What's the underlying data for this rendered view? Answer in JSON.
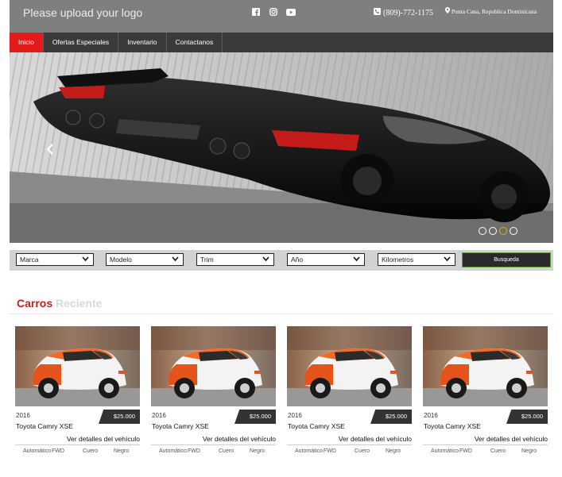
{
  "header": {
    "logo_text": "Please upload your logo",
    "social_icons": [
      "facebook-icon",
      "instagram-icon",
      "youtube-icon"
    ],
    "phone": "(809)-772-1175",
    "location": "Punta Cana, Republica Dominicana"
  },
  "nav": {
    "items": [
      {
        "label": "Inicio",
        "active": true
      },
      {
        "label": "Ofertas Especiales",
        "active": false
      },
      {
        "label": "Inventario",
        "active": false
      },
      {
        "label": "Contactanos",
        "active": false
      }
    ]
  },
  "slider": {
    "prev_icon": "chevron-left-icon",
    "dot_count": 4,
    "active_dot": 2
  },
  "search": {
    "filters": [
      "Marca",
      "Modelo",
      "Trim",
      "Año",
      "Kilometros"
    ],
    "button_label": "Busqueda"
  },
  "section": {
    "title_primary": "Carros",
    "title_secondary": "Reciente"
  },
  "cards": [
    {
      "year": "2016",
      "price": "$25.000",
      "model": "Toyota Camry XSE",
      "details_label": "Ver detalles del vehículo",
      "specs": [
        "Automático",
        "FWD",
        "Cuero",
        "Negro"
      ]
    },
    {
      "year": "2016",
      "price": "$25.000",
      "model": "Toyota Camry XSE",
      "details_label": "Ver detalles del vehículo",
      "specs": [
        "Automático",
        "FWD",
        "Cuero",
        "Negro"
      ]
    },
    {
      "year": "2016",
      "price": "$25.000",
      "model": "Toyota Camry XSE",
      "details_label": "Ver detalles del vehículo",
      "specs": [
        "Automático",
        "FWD",
        "Cuero",
        "Negro"
      ]
    },
    {
      "year": "2016",
      "price": "$25.000",
      "model": "Toyota Camry XSE",
      "details_label": "Ver detalles del vehículo",
      "specs": [
        "Automático",
        "FWD",
        "Cuero",
        "Negro"
      ]
    }
  ],
  "colors": {
    "accent": "#e21a1a",
    "nav_bg": "#3a3a3a",
    "topbar_bg": "#7f7f7f"
  }
}
